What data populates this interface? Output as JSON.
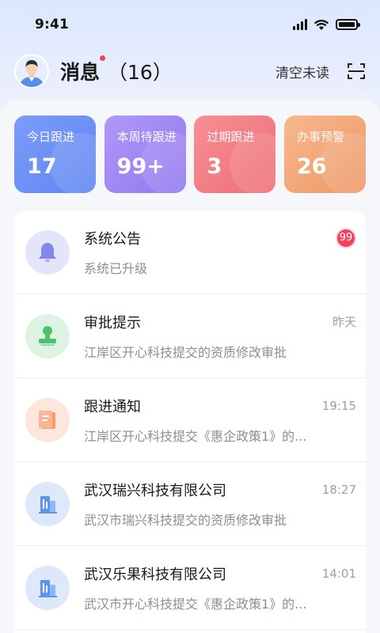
{
  "status_bar": {
    "time": "9:41"
  },
  "header": {
    "title": "消息",
    "count": "（16）",
    "clear_label": "清空未读"
  },
  "stats": [
    {
      "label": "今日跟进",
      "value": "17",
      "color": "#6d8ff7"
    },
    {
      "label": "本周待跟进",
      "value": "99+",
      "color": "#a28af4"
    },
    {
      "label": "过期跟进",
      "value": "3",
      "color": "#f27f86"
    },
    {
      "label": "办事预警",
      "value": "26",
      "color": "#f2a77c"
    }
  ],
  "messages": [
    {
      "icon": "bell-icon",
      "title": "系统公告",
      "subtitle": "系统已升级",
      "badge": "99",
      "time": ""
    },
    {
      "icon": "stamp-icon",
      "title": "审批提示",
      "subtitle": "江岸区开心科技提交的资质修改审批",
      "time": "昨天"
    },
    {
      "icon": "document-icon",
      "title": "跟进通知",
      "subtitle": "江岸区开心科技提交《惠企政策1》的...",
      "time": "19:15"
    },
    {
      "icon": "building-icon",
      "title": "武汉瑞兴科技有限公司",
      "subtitle": "武汉市瑞兴科技提交的资质修改审批",
      "time": "18:27"
    },
    {
      "icon": "building-icon",
      "title": "武汉乐果科技有限公司",
      "subtitle": "武汉市开心科技提交《惠企政策1》的...",
      "time": "14:01"
    }
  ]
}
